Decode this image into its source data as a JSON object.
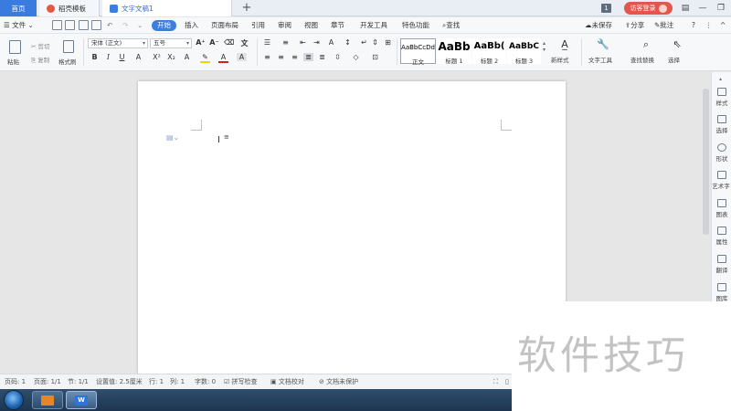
{
  "tabs": {
    "home": "首页",
    "templates": "稻壳模板",
    "document": "文字文稿1",
    "add": "+"
  },
  "titlebar": {
    "page_badge": "1",
    "visitor_login": "访客登录"
  },
  "menu": {
    "file": "文件",
    "items": [
      "开始",
      "插入",
      "页面布局",
      "引用",
      "审阅",
      "视图",
      "章节",
      "开发工具",
      "特色功能"
    ],
    "search": "查找",
    "unsaved": "未保存",
    "share": "分享",
    "comment": "批注",
    "help": "?"
  },
  "ribbon": {
    "paste": "粘贴",
    "cut": "剪切",
    "copy": "复制",
    "format_painter": "格式刷",
    "font_name": "宋体 (正文)",
    "font_size": "五号",
    "styles": [
      {
        "sample": "AaBbCcDd",
        "label": "正文"
      },
      {
        "sample": "AaBb",
        "label": "标题 1"
      },
      {
        "sample": "AaBb(",
        "label": "标题 2"
      },
      {
        "sample": "AaBbC",
        "label": "标题 3"
      }
    ],
    "new_style": "新样式",
    "text_tools": "文字工具",
    "find_replace": "查找替换",
    "select": "选择"
  },
  "side_panel": [
    "样式",
    "选择",
    "形状",
    "艺术字",
    "图表",
    "属性",
    "翻译",
    "图库"
  ],
  "statusbar": {
    "page_num": "页码: 1",
    "pages": "页面: 1/1",
    "section": "节: 1/1",
    "setting": "设置值: 2.5厘米",
    "row": "行: 1",
    "col": "列: 1",
    "word_count": "字数: 0",
    "spell_check": "拼写检查",
    "proofread": "文档校对",
    "protection": "文档未保护"
  },
  "watermark": "软件技巧"
}
